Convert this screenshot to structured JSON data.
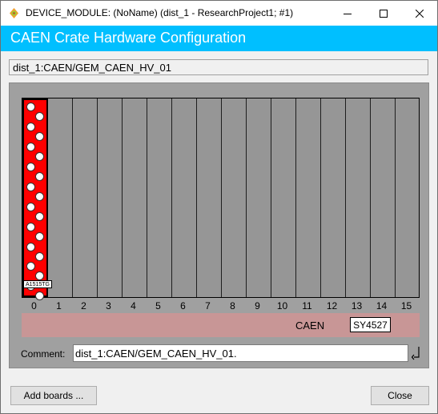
{
  "window": {
    "title": "DEVICE_MODULE: (NoName) (dist_1 - ResearchProject1; #1)",
    "icons": {
      "app": "app-icon",
      "minimize": "minimize-icon",
      "maximize": "maximize-icon",
      "close": "close-icon"
    }
  },
  "banner": {
    "title": "CAEN Crate Hardware Configuration"
  },
  "path": {
    "value": "dist_1:CAEN/GEM_CAEN_HV_01"
  },
  "crate": {
    "slots": [
      "0",
      "1",
      "2",
      "3",
      "4",
      "5",
      "6",
      "7",
      "8",
      "9",
      "10",
      "11",
      "12",
      "13",
      "14",
      "15"
    ],
    "boards": [
      {
        "slot": 0,
        "model": "A1515TG",
        "led_count": 20
      }
    ],
    "manufacturer": "CAEN",
    "model": "SY4527",
    "colors": {
      "board": "#ff0000",
      "frame": "#969696",
      "bar": "#c89696",
      "panel": "#a0a0a0"
    }
  },
  "comment": {
    "label": "Comment:",
    "value": "dist_1:CAEN/GEM_CAEN_HV_01.",
    "icon": "return-arrow-icon"
  },
  "buttons": {
    "add_boards": "Add boards ...",
    "close": "Close"
  },
  "colors": {
    "banner": "#00bfff"
  }
}
